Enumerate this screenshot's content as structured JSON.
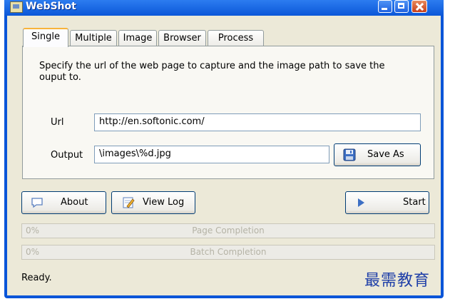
{
  "window": {
    "title": "WebShot"
  },
  "tabs": [
    {
      "label": "Single",
      "active": true
    },
    {
      "label": "Multiple",
      "active": false
    },
    {
      "label": "Image",
      "active": false
    },
    {
      "label": "Browser",
      "active": false
    },
    {
      "label": "Process",
      "active": false
    }
  ],
  "single": {
    "description": "Specify the url of the web page to capture and the image path to save the ouput to.",
    "url_label": "Url",
    "url_value": "http://en.softonic.com/",
    "output_label": "Output",
    "output_value": "\\images\\%d.jpg",
    "save_as_label": "Save As"
  },
  "actions": {
    "about_label": "About",
    "view_log_label": "View Log",
    "start_label": "Start"
  },
  "progress": {
    "page": {
      "percent_text": "0%",
      "caption": "Page Completion",
      "value": 0
    },
    "batch": {
      "percent_text": "0%",
      "caption": "Batch Completion",
      "value": 0
    }
  },
  "status": {
    "text": "Ready."
  },
  "watermark": {
    "text": "最需教育"
  }
}
